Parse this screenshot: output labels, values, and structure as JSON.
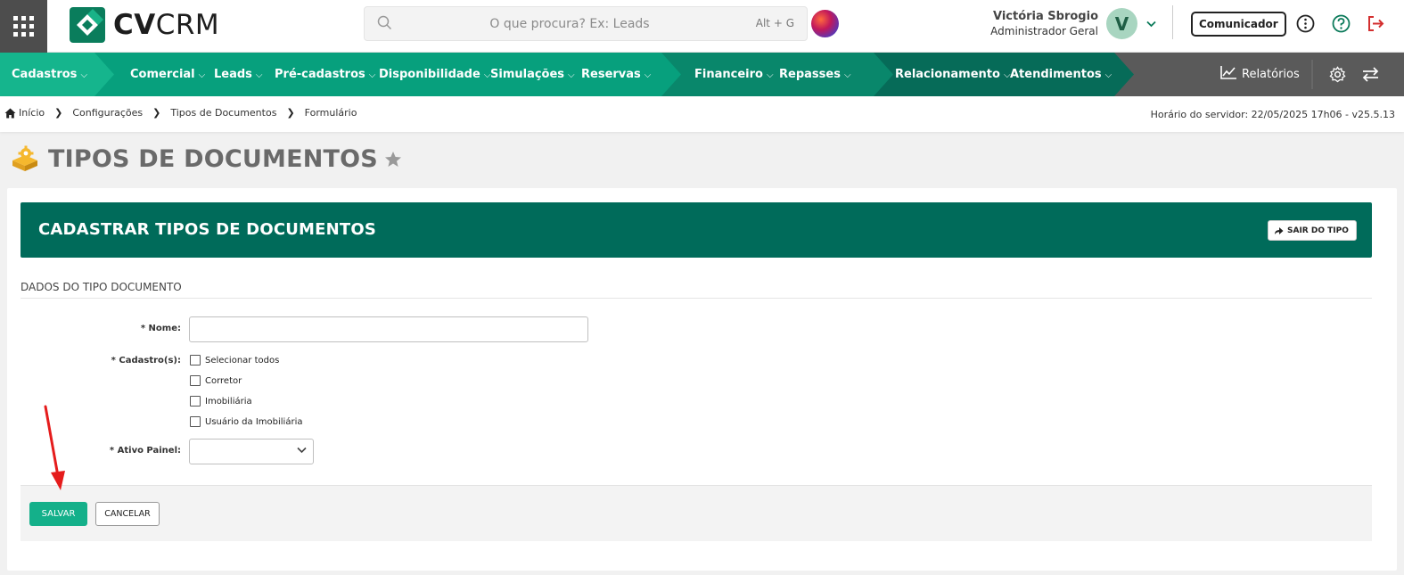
{
  "header": {
    "logo_bold": "CV",
    "logo_regular": "CRM",
    "search_placeholder": "O que procura? Ex: Leads",
    "search_shortcut": "Alt + G",
    "user_name": "Victória Sbrogio",
    "user_role": "Administrador Geral",
    "avatar_initial": "V",
    "comunicador_label": "Comunicador"
  },
  "nav": {
    "items": [
      {
        "label": "Cadastros"
      },
      {
        "label": "Comercial"
      },
      {
        "label": "Leads"
      },
      {
        "label": "Pré-cadastros"
      },
      {
        "label": "Disponibilidade"
      },
      {
        "label": "Simulações"
      },
      {
        "label": "Reservas"
      },
      {
        "label": "Financeiro"
      },
      {
        "label": "Repasses"
      },
      {
        "label": "Relacionamento"
      },
      {
        "label": "Atendimentos"
      }
    ],
    "reports_label": "Relatórios"
  },
  "breadcrumb": {
    "items": [
      "Início",
      "Configurações",
      "Tipos de Documentos",
      "Formulário"
    ],
    "server_time": "Horário do servidor: 22/05/2025 17h06 - v25.5.13"
  },
  "page": {
    "title": "TIPOS DE DOCUMENTOS"
  },
  "form": {
    "header_title": "CADASTRAR TIPOS DE DOCUMENTOS",
    "exit_button": "SAIR DO TIPO",
    "section_title": "DADOS DO TIPO DOCUMENTO",
    "name_label": "* Nome:",
    "name_value": "",
    "cadastros_label": "* Cadastro(s):",
    "options": [
      "Selecionar todos",
      "Corretor",
      "Imobiliária",
      "Usuário da Imobiliária"
    ],
    "ativo_label": "* Ativo Painel:",
    "ativo_value": "",
    "save_button": "SALVAR",
    "cancel_button": "CANCELAR"
  },
  "colors": {
    "nav_green": "#00a97b",
    "header_green": "#006b5a",
    "save_green": "#14b08a",
    "logout_red": "#d32f2f"
  }
}
